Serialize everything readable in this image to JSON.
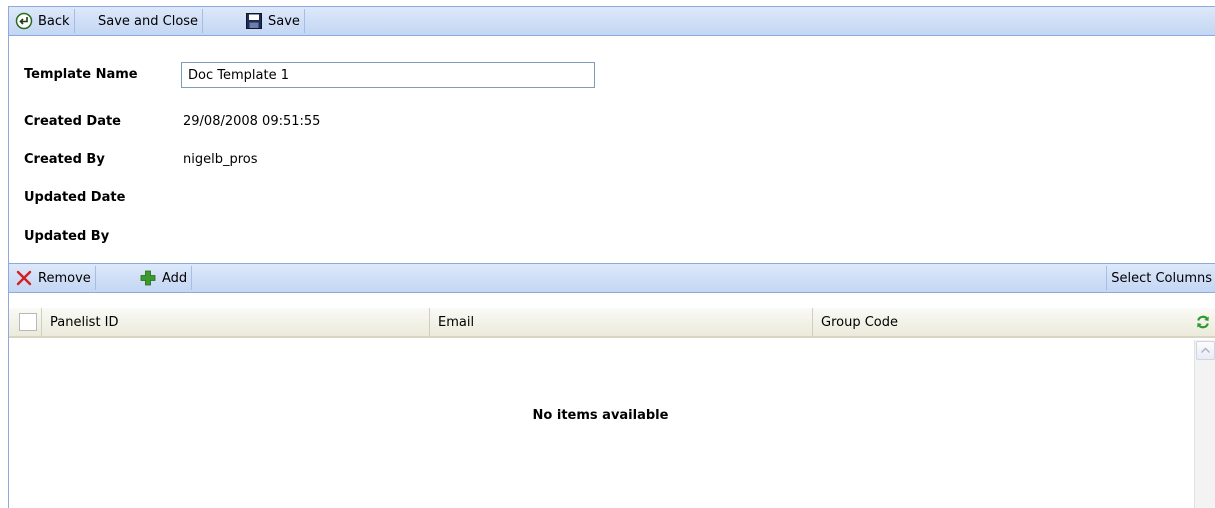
{
  "toolbar": {
    "back_label": "Back",
    "save_close_label": "Save and Close",
    "save_label": "Save"
  },
  "form": {
    "template_name_label": "Template Name",
    "template_name_value": "Doc Template 1",
    "created_date_label": "Created Date",
    "created_date_value": "29/08/2008 09:51:55",
    "created_by_label": "Created By",
    "created_by_value": "nigelb_pros",
    "updated_date_label": "Updated Date",
    "updated_date_value": "",
    "updated_by_label": "Updated By",
    "updated_by_value": ""
  },
  "grid_toolbar": {
    "remove_label": "Remove",
    "add_label": "Add",
    "select_columns_label": "Select Columns"
  },
  "grid": {
    "columns": [
      "Panelist ID",
      "Email",
      "Group Code"
    ],
    "empty_message": "No items available"
  },
  "colors": {
    "toolbar_bg": "#c3d6f3",
    "toolbar_border": "#8eaadb",
    "grid_header_bg": "#ebeadb",
    "remove_icon": "#d42020",
    "add_icon": "#3c9a2c",
    "refresh_icon": "#2f9a2a"
  },
  "icons": {
    "back": "back-arrow-circle-icon",
    "save": "floppy-disk-icon",
    "remove": "red-x-icon",
    "add": "green-plus-icon",
    "refresh": "refresh-icon",
    "scroll_up": "chevron-up-icon"
  }
}
